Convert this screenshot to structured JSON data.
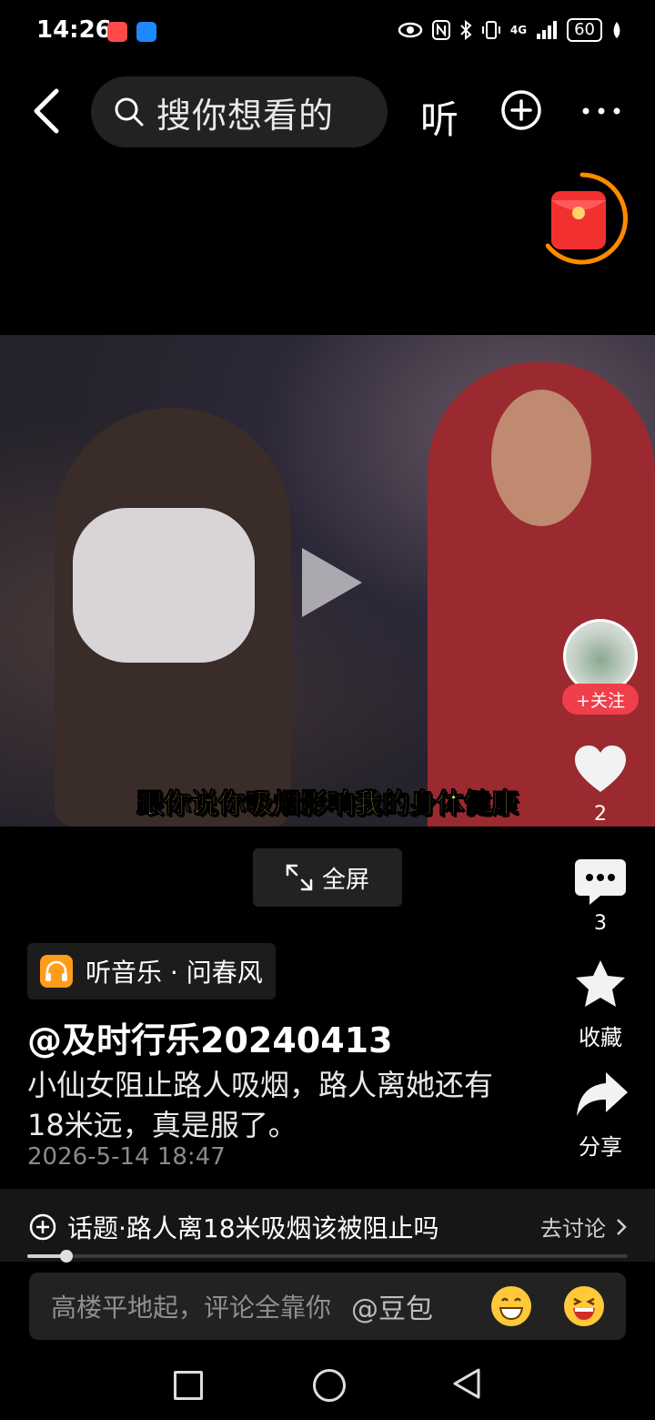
{
  "status_bar": {
    "time": "14:26",
    "network": "4G",
    "battery": "60"
  },
  "top_bar": {
    "search_placeholder": "搜你想看的",
    "listen_label": "听"
  },
  "video": {
    "subtitle": "跟你说你吸烟影响我的身体健康"
  },
  "side_actions": {
    "follow_label": "+关注",
    "like_count": "2",
    "comment_count": "3",
    "favorite_label": "收藏",
    "share_label": "分享"
  },
  "fullscreen_label": "全屏",
  "music_tag": "听音乐 · 问春风",
  "post": {
    "author": "@及时行乐20240413",
    "caption": "小仙女阻止路人吸烟，路人离她还有18米远，真是服了。",
    "date": "2026-5-14 18:47"
  },
  "topic": {
    "label": "话题·路人离18米吸烟该被阻止吗",
    "action": "去讨论"
  },
  "playback_progress": 0.065,
  "comment": {
    "placeholder": "高楼平地起，评论全靠你",
    "mention": "@豆包"
  },
  "colors": {
    "accent_red": "#f03e4a",
    "subtitle_yellow": "#ffe33a",
    "music_orange": "#ff9d1a"
  }
}
